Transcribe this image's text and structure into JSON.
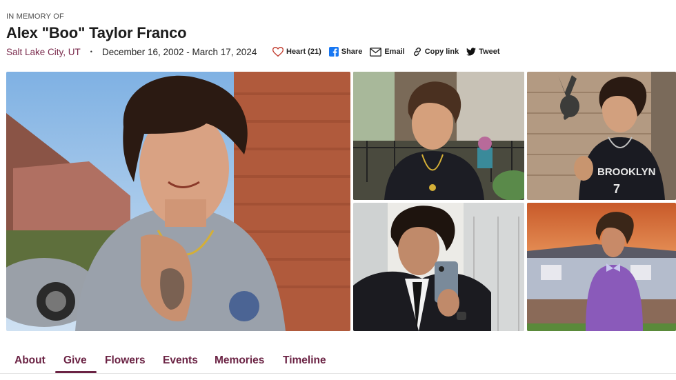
{
  "header": {
    "eyebrow": "IN MEMORY OF",
    "name": "Alex \"Boo\" Taylor Franco",
    "location": "Salt Lake City, UT",
    "separator": "•",
    "dates": "December 16, 2002 - March 17, 2024"
  },
  "actions": {
    "heart": {
      "label": "Heart (21)",
      "icon": "heart-icon"
    },
    "share": {
      "label": "Share",
      "icon": "facebook-icon"
    },
    "email": {
      "label": "Email",
      "icon": "envelope-icon"
    },
    "copy": {
      "label": "Copy link",
      "icon": "link-icon"
    },
    "tweet": {
      "label": "Tweet",
      "icon": "twitter-icon"
    }
  },
  "gallery": {
    "photos": [
      {
        "alt": "Main portrait photo"
      },
      {
        "alt": "Photo with gold chain"
      },
      {
        "alt": "Photo in Brooklyn jersey"
      },
      {
        "alt": "Mirror selfie in suit"
      },
      {
        "alt": "Photo at sunset in purple shirt"
      }
    ]
  },
  "tabs": {
    "items": [
      {
        "label": "About"
      },
      {
        "label": "Give"
      },
      {
        "label": "Flowers"
      },
      {
        "label": "Events"
      },
      {
        "label": "Memories"
      },
      {
        "label": "Timeline"
      }
    ],
    "active": "Give"
  },
  "colors": {
    "accent": "#6b2344",
    "location": "#7a2a4c",
    "heart": "#c0392b",
    "facebook": "#1877f2"
  }
}
